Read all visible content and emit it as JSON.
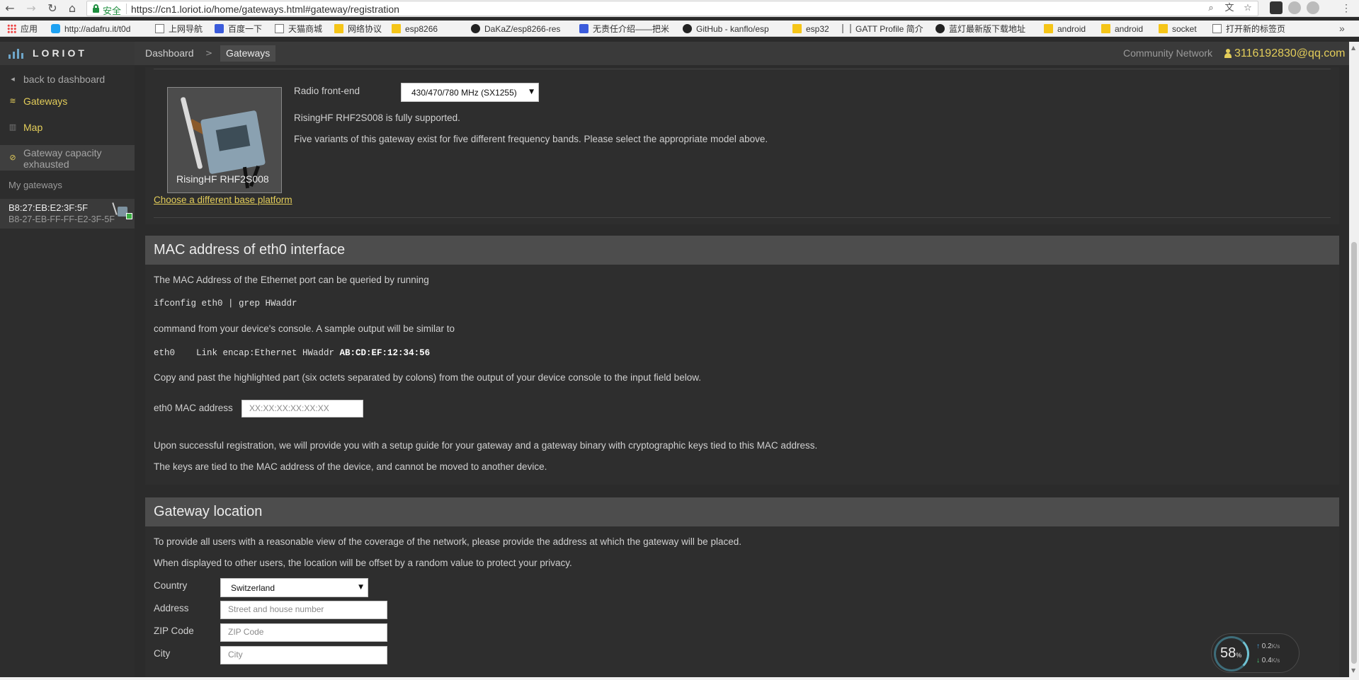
{
  "browser": {
    "secure_label": "安全",
    "url": "https://cn1.loriot.io/home/gateways.html#gateway/registration",
    "bookmarks": [
      "应用",
      "http://adafru.it/t0d",
      "上网导航",
      "百度一下",
      "天猫商城",
      "网络协议",
      "esp8266",
      "DaKaZ/esp8266-res",
      "无责任介绍——把米",
      "GitHub - kanflo/esp",
      "esp32",
      "GATT Profile 简介",
      "蓝灯最新版下载地址",
      "android",
      "android",
      "socket",
      "打开新的标签页"
    ],
    "more": "»"
  },
  "app": {
    "logo": "LORIOT",
    "breadcrumb": {
      "dashboard": "Dashboard",
      "separator": ">",
      "current": "Gateways"
    },
    "community": "Community Network",
    "user_email": "3116192830@qq.com"
  },
  "sidebar": {
    "back": "back to dashboard",
    "gateways": "Gateways",
    "map": "Map",
    "capacity": "Gateway capacity exhausted",
    "my_gateways": "My gateways",
    "gateway_mac": "B8:27:EB:E2:3F:5F",
    "gateway_id": "B8-27-EB-FF-FF-E2-3F-5F"
  },
  "platform": {
    "radio_label": "Radio front-end",
    "radio_value": "430/470/780 MHz (SX1255)",
    "supported": "RisingHF RHF2S008 is fully supported.",
    "variants": "Five variants of this gateway exist for five different frequency bands. Please select the appropriate model above.",
    "model": "RisingHF RHF2S008",
    "change_link": "Choose a different base platform"
  },
  "mac": {
    "title": "MAC address of eth0 interface",
    "intro": "The MAC Address of the Ethernet port can be queried by running",
    "command": "ifconfig eth0 | grep HWaddr",
    "after": "command from your device's console. A sample output will be similar to",
    "sample_prefix": "eth0    Link encap:Ethernet HWaddr ",
    "sample_mac": "AB:CD:EF:12:34:56",
    "copy": "Copy and past the highlighted part (six octets separated by colons) from the output of your device console to the input field below.",
    "field_label": "eth0 MAC address",
    "field_placeholder": "XX:XX:XX:XX:XX:XX",
    "note1": "Upon successful registration, we will provide you with a setup guide for your gateway and a gateway binary with cryptographic keys tied to this MAC address.",
    "note2": "The keys are tied to the MAC address of the device, and cannot be moved to another device."
  },
  "location": {
    "title": "Gateway location",
    "intro1": "To provide all users with a reasonable view of the coverage of the network, please provide the address at which the gateway will be placed.",
    "intro2": "When displayed to other users, the location will be offset by a random value to protect your privacy.",
    "country_label": "Country",
    "country_value": "Switzerland",
    "address_label": "Address",
    "address_placeholder": "Street and house number",
    "zip_label": "ZIP Code",
    "zip_placeholder": "ZIP Code",
    "city_label": "City",
    "city_placeholder": "City"
  },
  "speed_widget": {
    "value": "58",
    "unit": "%",
    "up": "0.2",
    "down": "0.4",
    "rate_unit": "K/s"
  },
  "colors": {
    "accent": "#e3cd5a",
    "panel": "#2e2e2e",
    "header": "#4d4d4d"
  }
}
